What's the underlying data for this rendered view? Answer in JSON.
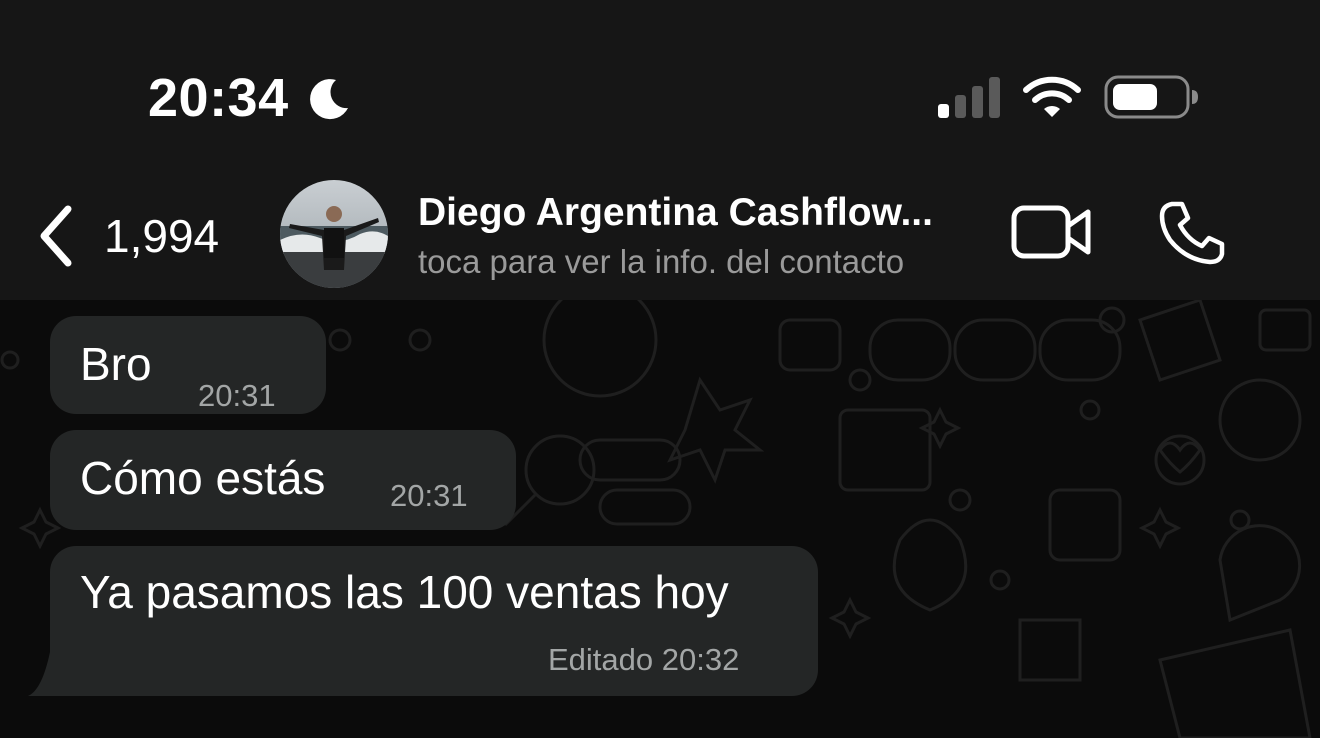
{
  "status_bar": {
    "time": "20:34",
    "icons": [
      "moon-icon",
      "signal-icon",
      "wifi-icon",
      "battery-icon"
    ]
  },
  "header": {
    "back_count": "1,994",
    "contact_name": "Diego Argentina Cashflow...",
    "contact_subtitle": "toca para ver la info. del contacto",
    "icons": [
      "back-chevron-icon",
      "video-call-icon",
      "phone-icon"
    ]
  },
  "messages": [
    {
      "text": "Bro",
      "time": "20:31"
    },
    {
      "text": "Cómo estás",
      "time": "20:31"
    },
    {
      "text": "Ya pasamos las 100 ventas hoy",
      "time": "Editado 20:32"
    }
  ],
  "colors": {
    "header_bg": "#161616",
    "chat_bg": "#0b0b0b",
    "bubble_bg": "#242626",
    "timestamp": "#a3a6a6",
    "subtitle": "#9a9a9a"
  }
}
